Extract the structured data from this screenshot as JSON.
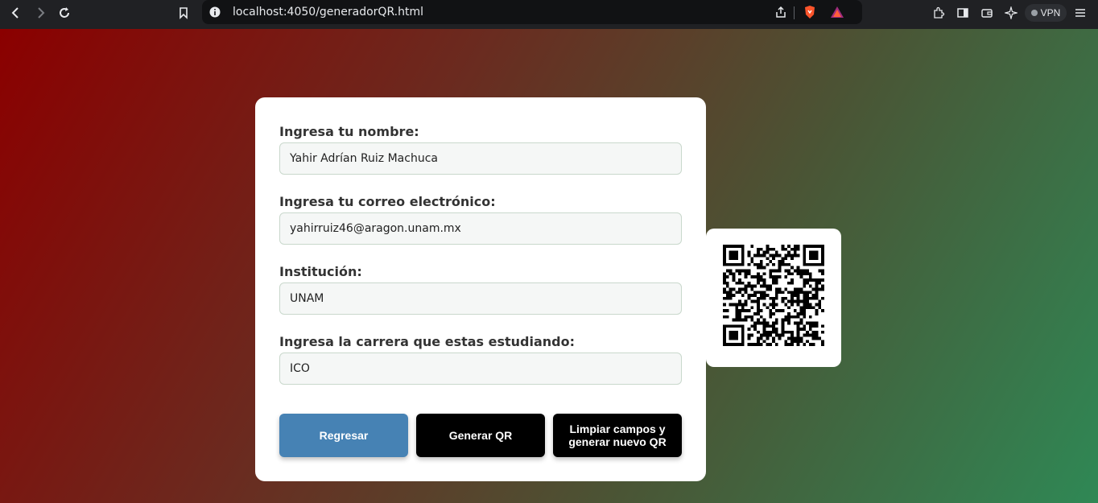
{
  "browser": {
    "url": "localhost:4050/generadorQR.html",
    "vpn_label": "VPN"
  },
  "form": {
    "fields": [
      {
        "label": "Ingresa tu nombre:",
        "value": "Yahir Adrían Ruiz Machuca"
      },
      {
        "label": "Ingresa tu correo electrónico:",
        "value": "yahirruiz46@aragon.unam.mx"
      },
      {
        "label": "Institución:",
        "value": "UNAM"
      },
      {
        "label": "Ingresa la carrera que estas estudiando:",
        "value": "ICO"
      }
    ],
    "buttons": {
      "back": "Regresar",
      "generate": "Generar QR",
      "clear": "Limpiar campos y generar nuevo QR"
    }
  },
  "colors": {
    "back_button": "#4682b4",
    "primary_button": "#000000",
    "bg_start": "#8b0000",
    "bg_end": "#2f8855"
  }
}
